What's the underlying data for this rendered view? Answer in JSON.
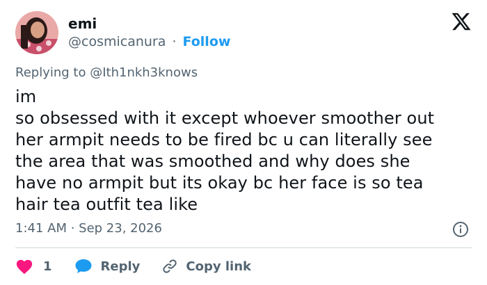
{
  "author": {
    "display_name": "emi",
    "handle": "@cosmicanura",
    "separator": "·",
    "follow_label": "Follow"
  },
  "reply_context": {
    "prefix": "Replying to",
    "mention": "@Ith1nkh3knows"
  },
  "tweet": {
    "text": "im\nso obsessed with it except whoever smoother out\nher armpit needs to be fired bc u can literally see\nthe area that was smoothed and why does she\nhave no armpit but its okay bc her face is so tea\nhair tea outfit tea like",
    "timestamp": "1:41 AM · Sep 23, 2026"
  },
  "actions": {
    "like_count": "1",
    "reply_label": "Reply",
    "copy_link_label": "Copy link"
  },
  "colors": {
    "accent": "#1d9bf0",
    "like": "#f91880",
    "muted": "#536471",
    "text": "#0f1419",
    "divider": "#cfd9de"
  },
  "icons": {
    "brand": "x-logo-icon",
    "info": "info-icon",
    "like": "heart-icon",
    "reply": "speech-bubble-icon",
    "copy_link": "link-icon"
  }
}
